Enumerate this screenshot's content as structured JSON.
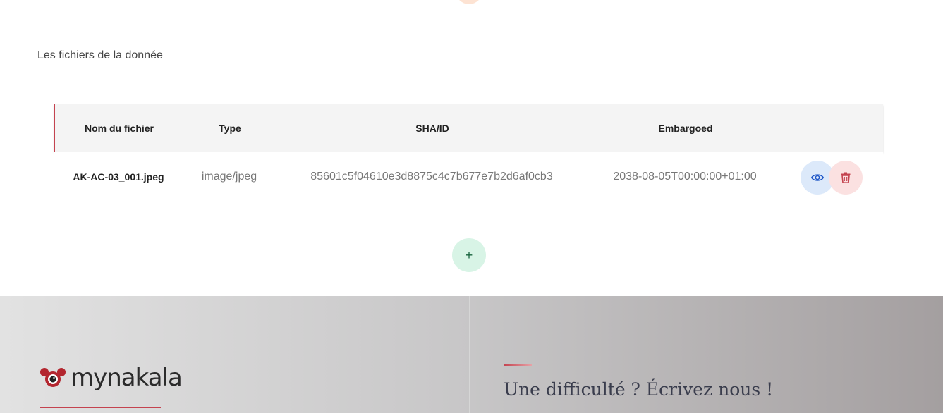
{
  "files_section": {
    "title": "Les fichiers de la donnée",
    "columns": [
      "Nom du fichier",
      "Type",
      "SHA/ID",
      "Embargoed"
    ],
    "rows": [
      {
        "name": "AK-AC-03_001.jpeg",
        "type": "image/jpeg",
        "sha": "85601c5f04610e3d8875c4c7b677e7b2d6af0cb3",
        "embargoed": "2038-08-05T00:00:00+01:00"
      }
    ],
    "actions": {
      "view_icon": "eye-icon",
      "delete_icon": "trash-icon"
    },
    "add_label": "+"
  },
  "footer": {
    "logo_text": "mynakala",
    "contact_title": "Une difficulté ? Écrivez nous !"
  },
  "colors": {
    "accent": "#c4434f",
    "view_button_bg": "#dce9fa",
    "view_icon": "#1e56c7",
    "delete_button_bg": "#fbe1e1",
    "delete_icon": "#c4434f",
    "add_button_bg": "#d8f4e6",
    "add_icon": "#17633d"
  }
}
